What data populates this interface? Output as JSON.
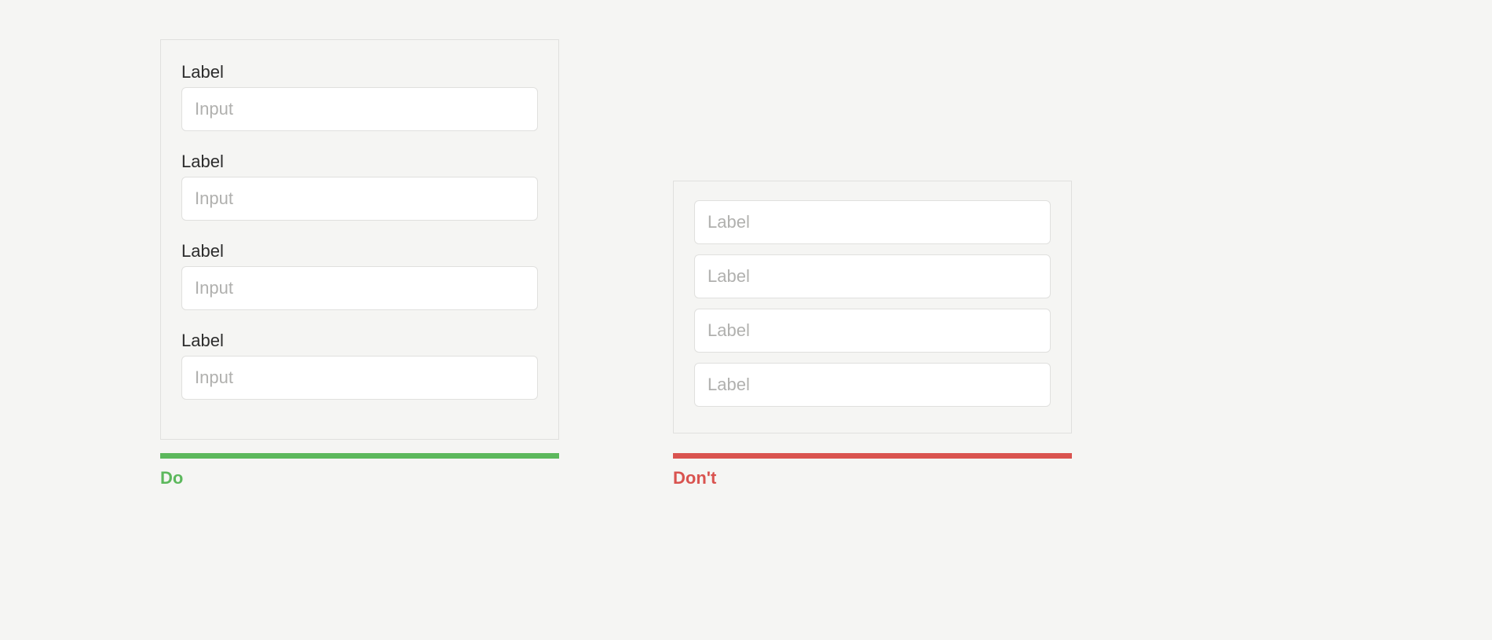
{
  "do": {
    "caption": "Do",
    "fields": [
      {
        "label": "Label",
        "placeholder": "Input"
      },
      {
        "label": "Label",
        "placeholder": "Input"
      },
      {
        "label": "Label",
        "placeholder": "Input"
      },
      {
        "label": "Label",
        "placeholder": "Input"
      }
    ]
  },
  "dont": {
    "caption": "Don't",
    "fields": [
      {
        "placeholder": "Label"
      },
      {
        "placeholder": "Label"
      },
      {
        "placeholder": "Label"
      },
      {
        "placeholder": "Label"
      }
    ]
  },
  "colors": {
    "do": "#5cb85c",
    "dont": "#d9534f"
  }
}
